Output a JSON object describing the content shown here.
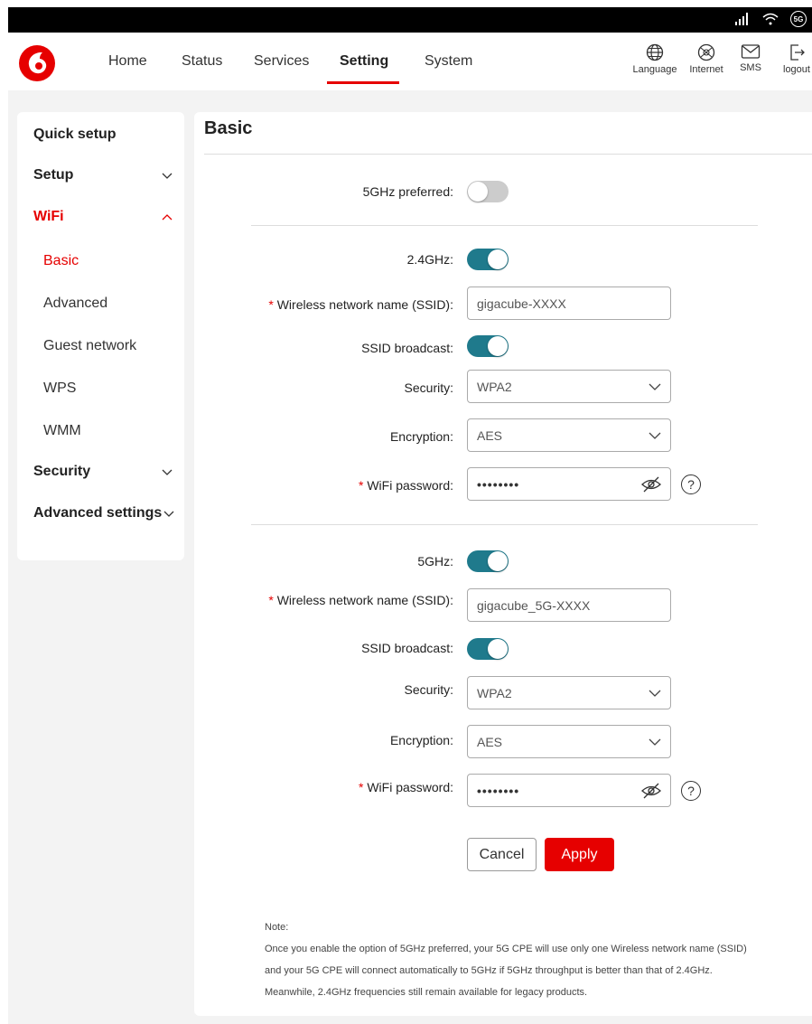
{
  "colors": {
    "accent": "#e60000",
    "toggle_on": "#1f7a8c",
    "toggle_off": "#cccccc"
  },
  "statusbar": {
    "icons": [
      "signal-icon",
      "wifi-icon",
      "5g-icon"
    ],
    "network_badge": "5G"
  },
  "nav": {
    "items": [
      "Home",
      "Status",
      "Services",
      "Setting",
      "System"
    ],
    "active": "Setting",
    "icons": [
      {
        "icon": "globe-icon",
        "label": "Language"
      },
      {
        "icon": "internet-icon",
        "label": "Internet"
      },
      {
        "icon": "mail-icon",
        "label": "SMS"
      },
      {
        "icon": "logout-icon",
        "label": "logout"
      }
    ]
  },
  "sidebar": {
    "items": [
      {
        "label": "Quick setup",
        "expandable": false
      },
      {
        "label": "Setup",
        "expandable": true,
        "expanded": false
      },
      {
        "label": "WiFi",
        "expandable": true,
        "expanded": true
      },
      {
        "label": "Security",
        "expandable": true,
        "expanded": false
      },
      {
        "label": "Advanced settings",
        "expandable": true,
        "expanded": false
      }
    ],
    "wifi_sub": [
      "Basic",
      "Advanced",
      "Guest network",
      "WPS",
      "WMM"
    ],
    "active_sub": "Basic"
  },
  "main": {
    "title": "Basic",
    "preferred_label": "5GHz preferred:",
    "preferred_on": false,
    "band24": {
      "label": "2.4GHz:",
      "enabled": true,
      "ssid_label": "Wireless network name (SSID):",
      "ssid_value": "gigacube-XXXX",
      "broadcast_label": "SSID broadcast:",
      "broadcast_on": true,
      "security_label": "Security:",
      "security_value": "WPA2",
      "encryption_label": "Encryption:",
      "encryption_value": "AES",
      "password_label": "WiFi password:",
      "password_value": "••••••••"
    },
    "band5": {
      "label": "5GHz:",
      "enabled": true,
      "ssid_label": "Wireless network name (SSID):",
      "ssid_value": "gigacube_5G-XXXX",
      "broadcast_label": "SSID broadcast:",
      "broadcast_on": true,
      "security_label": "Security:",
      "security_value": "WPA2",
      "encryption_label": "Encryption:",
      "encryption_value": "AES",
      "password_label": "WiFi password:",
      "password_value": "••••••••"
    },
    "required_mark": "*",
    "help_mark": "?",
    "cancel_label": "Cancel",
    "apply_label": "Apply",
    "note": {
      "title": "Note:",
      "lines": [
        "Once you enable the option of 5GHz preferred, your 5G CPE will use only one Wireless network name (SSID)",
        "and your 5G CPE will connect automatically to 5GHz if 5GHz throughput is better than that of 2.4GHz.",
        "Meanwhile, 2.4GHz frequencies still remain available for legacy products."
      ]
    }
  }
}
